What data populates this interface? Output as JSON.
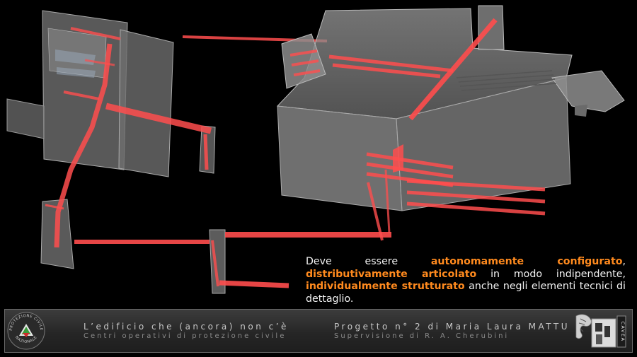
{
  "caption": {
    "seg1": "Deve essere ",
    "hl1": "autonomamente configurato",
    "seg2": ", ",
    "hl2": "distributivamente articolato",
    "seg3": " in modo indipendente, ",
    "hl3": "individualmente strutturato",
    "seg4": " anche negli elementi tecnici di dettaglio."
  },
  "footer": {
    "title_left": "L’edificio che (ancora) non c’è",
    "subtitle_left": "Centri operativi di protezione civile",
    "title_right": "Progetto n° 2 di Maria Laura MATTU",
    "subtitle_right": "Supervisione di R. A. Cherubini"
  },
  "logo_left": {
    "text_top": "PROTEZIONE CIVILE",
    "text_bottom": "NAZIONALE"
  },
  "logo_right": {
    "text": "CAVEA"
  },
  "colors": {
    "accent": "#ff8a1e",
    "highlight_red": "#ff4d4d",
    "building_gray": "#8c8c8c"
  }
}
